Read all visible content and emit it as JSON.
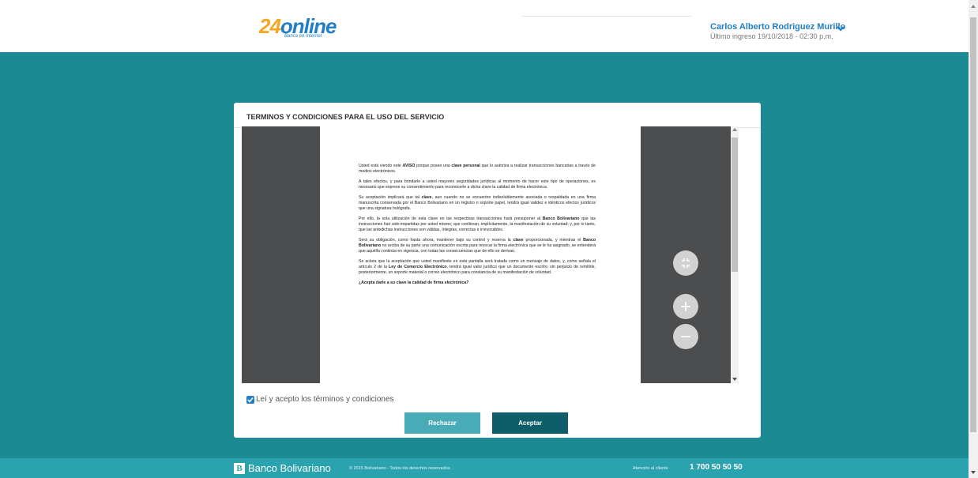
{
  "header": {
    "logo_main": "online",
    "logo_num": "24",
    "logo_sub": "Banca en Internet",
    "user_name": "Carlos Alberto Rodriguez Murillo",
    "last_login": "Último ingreso 19/10/2018 - 02:30 p.m.",
    "user_menu_icon": "chevron-down-icon"
  },
  "modal": {
    "title": "TERMINOS Y CONDICIONES PARA EL USO DEL SERVICIO",
    "viewer_controls": [
      "fit-page-icon",
      "zoom-in-icon",
      "zoom-out-icon"
    ],
    "accept_label": "Leí y acepto los términos y condiciones",
    "accept_checked": true,
    "reject_button": "Rechazar",
    "accept_button": "Aceptar"
  },
  "document": {
    "p1": [
      "Usted está viendo este ",
      "AVISO",
      " porque posee una ",
      "clave personal",
      " que lo autoriza a realizar transacciones bancarias a través de medios electrónicos."
    ],
    "p2": "A tales efectos, y para brindarle a usted mayores seguridades jurídicas al momento de hacer este tipo de operaciones, es necesario que exprese su consentimiento para reconocerle a dicha clave la calidad de firma electrónica.",
    "p3": [
      "Su aceptación implicará que tal ",
      "clave",
      ", aun cuando no se encuentre indisolublemente asociada o respaldada en una firma manuscrita conservada por el Banco Bolivariano en un registro o soporte papel, tendrá igual validez e idénticos efectos jurídicos que una signatura hológrafa."
    ],
    "p4": [
      "Por ello, la sola utilización de esta clave en las respectivas transacciones hará presuponer al ",
      "Banco Bolivariano",
      " que las instrucciones han sido impartidas por usted mismo; que conllevan, implícitamente, la manifestación de su voluntad; y, por lo tanto, que las antedichas instrucciones son válidas, íntegras, correctas e irrevocables."
    ],
    "p5": [
      "Será su obligación, como hasta ahora, mantener bajo su control y reserva la ",
      "clave",
      " proporcionada, y mientras el ",
      "Banco Bolivariano",
      " no reciba de su parte una comunicación escrita para revocar la firma electrónica que se le ha asignado, se entenderá que aquélla continúa en vigencia, con todas las consecuencias que de ello se derivan."
    ],
    "p6": [
      "Se aclara que la aceptación que usted manifieste en esta pantalla será tratada como un mensaje de datos, y, como señala el artículo 2 de la ",
      "Ley de Comercio Electrónico",
      ", tendrá igual valor jurídico que un documento escrito; sin perjuicio de remitirle, posteriormente, un soporte material o correo electrónico para constancia de su manifestación de voluntad."
    ],
    "question": "¿Acepta darle a su clave la calidad de firma electrónica?"
  },
  "footer": {
    "bank_logo_letter": "B",
    "bank_name": "Banco Bolivariano",
    "copyright": "© 2015 Bolivariano - Todos los derechos reservados.",
    "support_label": "Atención al cliente",
    "support_phone": "1 700 50 50 50"
  },
  "colors": {
    "background": "#1b8a93",
    "brand_blue": "#1f7ec7",
    "brand_orange": "#f5a623",
    "reject": "#49abb5",
    "accept": "#0d5e68",
    "footer": "#2aa3ae"
  }
}
